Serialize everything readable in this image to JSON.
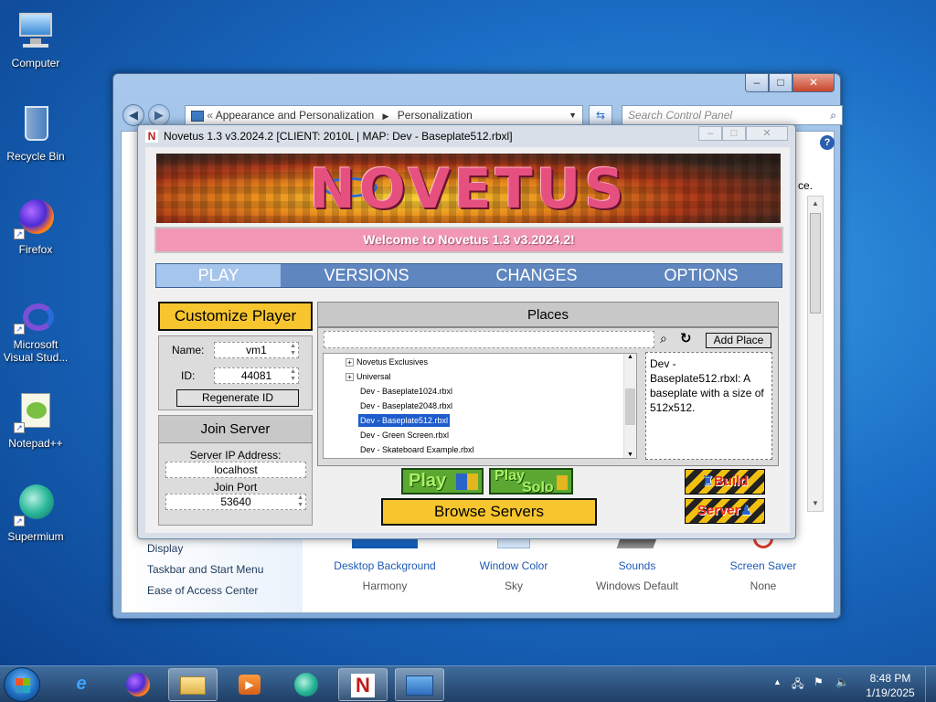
{
  "desktop": {
    "icons": [
      {
        "label": "Computer"
      },
      {
        "label": "Recycle Bin"
      },
      {
        "label": "Firefox"
      },
      {
        "label": "Microsoft Visual Stud..."
      },
      {
        "label": "Notepad++"
      },
      {
        "label": "Supermium"
      }
    ]
  },
  "control_panel": {
    "breadcrumb": [
      "Appearance and Personalization",
      "Personalization"
    ],
    "search_placeholder": "Search Control Panel",
    "partial_text": "ce.",
    "left_links": [
      "Display",
      "Taskbar and Start Menu",
      "Ease of Access Center"
    ],
    "tiles": [
      {
        "title": "Desktop Background",
        "value": "Harmony"
      },
      {
        "title": "Window Color",
        "value": "Sky"
      },
      {
        "title": "Sounds",
        "value": "Windows Default"
      },
      {
        "title": "Screen Saver",
        "value": "None"
      }
    ],
    "window_buttons": {
      "minimize": "–",
      "maximize": "□",
      "close": "✕"
    }
  },
  "novetus": {
    "title": "Novetus 1.3 v3.2024.2 [CLIENT: 2010L | MAP: Dev - Baseplate512.rbxl]",
    "title_icon": "N",
    "banner_text": "NOVETUS",
    "welcome": "Welcome to Novetus 1.3 v3.2024.2!",
    "tabs": [
      "PLAY",
      "VERSIONS",
      "CHANGES",
      "OPTIONS"
    ],
    "active_tab": "PLAY",
    "customize_player": "Customize Player",
    "name_label": "Name:",
    "name_value": "vm1",
    "id_label": "ID:",
    "id_value": "44081",
    "regenerate_id": "Regenerate ID",
    "join_server": "Join Server",
    "server_ip_label": "Server IP Address:",
    "server_ip_value": "localhost",
    "join_port_label": "Join Port",
    "join_port_value": "53640",
    "places_header": "Places",
    "add_place": "Add Place",
    "tree": [
      {
        "label": "Novetus Exclusives",
        "expandable": true
      },
      {
        "label": "Universal",
        "expandable": true
      },
      {
        "label": "Dev - Baseplate1024.rbxl",
        "expandable": false
      },
      {
        "label": "Dev - Baseplate2048.rbxl",
        "expandable": false
      },
      {
        "label": "Dev - Baseplate512.rbxl",
        "expandable": false,
        "selected": true
      },
      {
        "label": "Dev - Green Screen.rbxl",
        "expandable": false
      },
      {
        "label": "Dev - Skateboard Example.rbxl",
        "expandable": false
      }
    ],
    "description": "Dev - Baseplate512.rbxl: A baseplate with a size of 512x512.",
    "play": "Play",
    "play_solo_1": "Play",
    "play_solo_2": "Solo",
    "browse_servers": "Browse Servers",
    "build": "Build",
    "server": "Server"
  },
  "taskbar": {
    "time": "8:48 PM",
    "date": "1/19/2025"
  }
}
